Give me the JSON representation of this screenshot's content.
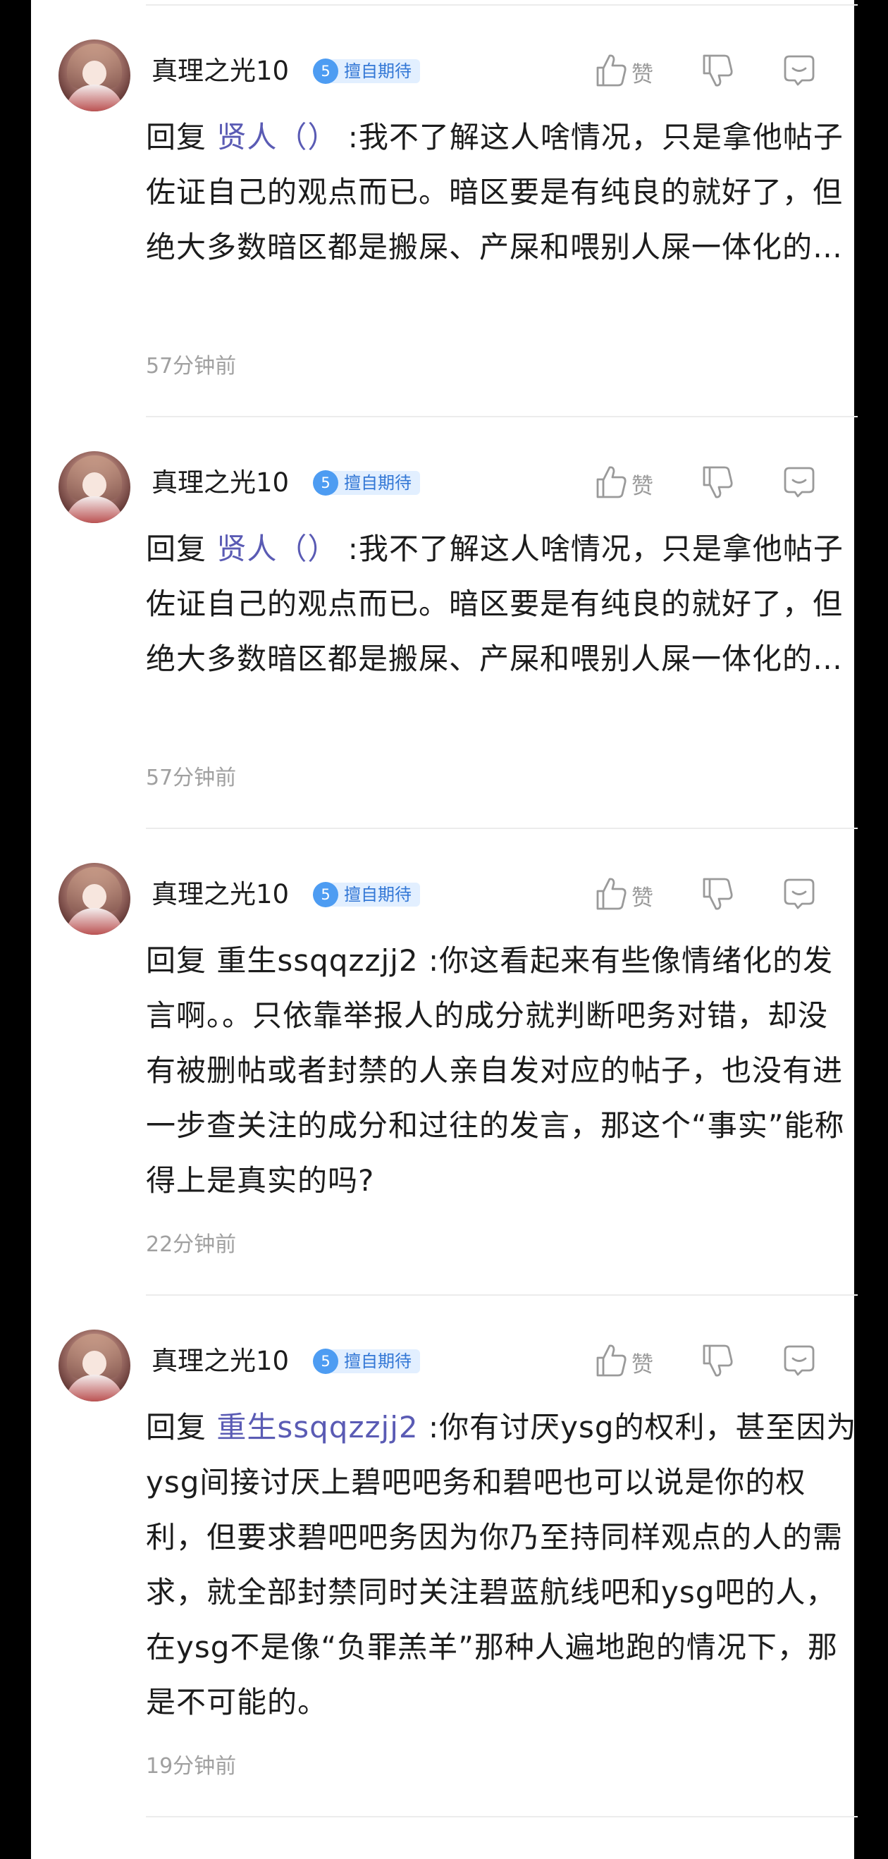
{
  "comments": [
    {
      "username": "真理之光10",
      "badge_level": "5",
      "badge_label": "擅自期待",
      "like_label": "赞",
      "reply_prefix": "回复 ",
      "mention": "贤人（）",
      "mention_linked": true,
      "text": " :我不了解这人啥情况，只是拿他帖子佐证自己的观点而已。暗区要是有纯良的就好了，但绝大多数暗区都是搬屎、产屎和喂别人屎一体化的…",
      "time": "57分钟前"
    },
    {
      "username": "真理之光10",
      "badge_level": "5",
      "badge_label": "擅自期待",
      "like_label": "赞",
      "reply_prefix": "回复 ",
      "mention": "贤人（）",
      "mention_linked": true,
      "text": " :我不了解这人啥情况，只是拿他帖子佐证自己的观点而已。暗区要是有纯良的就好了，但绝大多数暗区都是搬屎、产屎和喂别人屎一体化的…",
      "time": "57分钟前"
    },
    {
      "username": "真理之光10",
      "badge_level": "5",
      "badge_label": "擅自期待",
      "like_label": "赞",
      "reply_prefix": "回复 ",
      "mention": "重生ssqqzzjj2",
      "mention_linked": false,
      "text": " :你这看起来有些像情绪化的发言啊。。只依靠举报人的成分就判断吧务对错，却没有被删帖或者封禁的人亲自发对应的帖子，也没有进一步查关注的成分和过往的发言，那这个“事实”能称得上是真实的吗?",
      "time": "22分钟前"
    },
    {
      "username": "真理之光10",
      "badge_level": "5",
      "badge_label": "擅自期待",
      "like_label": "赞",
      "reply_prefix": "回复 ",
      "mention": "重生ssqqzzjj2",
      "mention_linked": true,
      "text": " :你有讨厌ysg的权利，甚至因为ysg间接讨厌上碧吧吧务和碧吧也可以说是你的权利，但要求碧吧吧务因为你乃至持同样观点的人的需求，就全部封禁同时关注碧蓝航线吧和ysg吧的人，在ysg不是像“负罪羔羊”那种人遍地跑的情况下，那是不可能的。",
      "time": "19分钟前"
    }
  ]
}
